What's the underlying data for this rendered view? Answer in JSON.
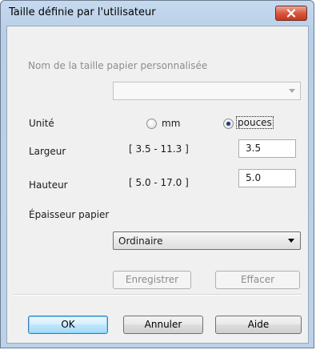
{
  "window": {
    "title": "Taille définie par l'utilisateur",
    "close_icon": "close-icon"
  },
  "paper_name": {
    "label": "Nom de la taille papier personnalisée",
    "value": ""
  },
  "unit": {
    "label": "Unité",
    "options": [
      {
        "label": "mm",
        "selected": false
      },
      {
        "label": "pouces",
        "selected": true
      }
    ]
  },
  "width": {
    "label": "Largeur",
    "range": "[ 3.5 - 11.3 ]",
    "value": "3.5"
  },
  "height": {
    "label": "Hauteur",
    "range": "[ 5.0 - 17.0 ]",
    "value": "5.0"
  },
  "paper_thickness": {
    "label": "Épaisseur papier",
    "selected": "Ordinaire"
  },
  "buttons": {
    "save": "Enregistrer",
    "delete": "Effacer",
    "ok": "OK",
    "cancel": "Annuler",
    "help": "Aide"
  }
}
